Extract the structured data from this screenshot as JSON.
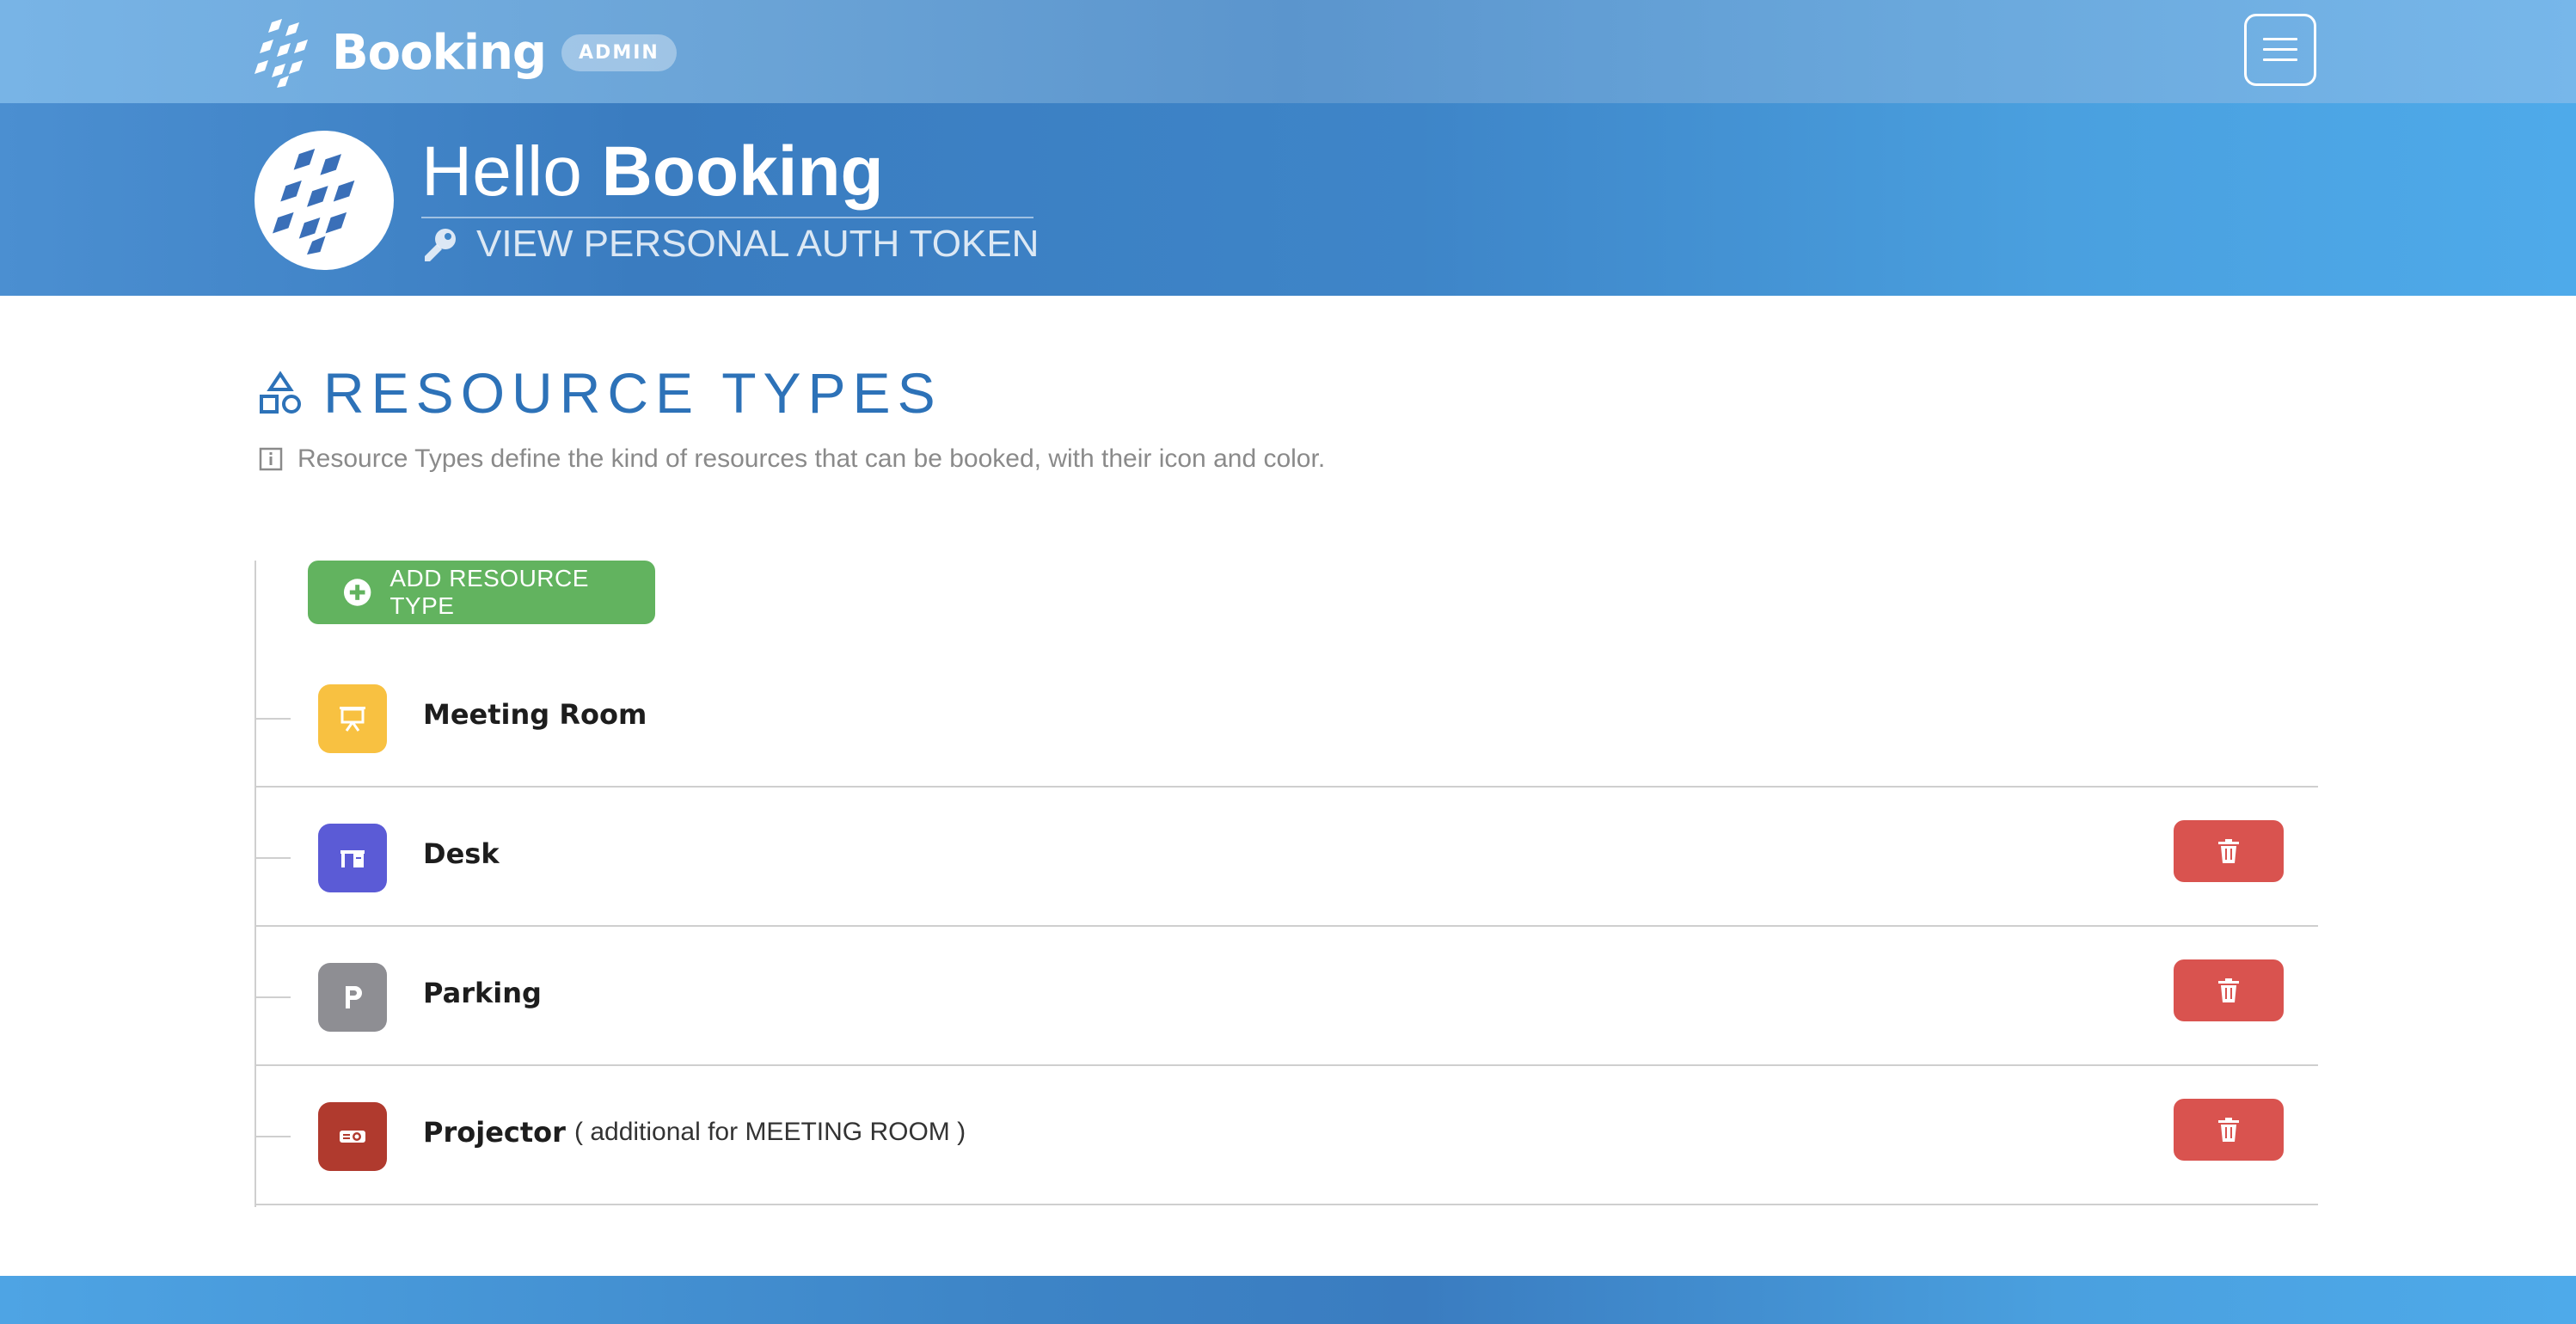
{
  "header": {
    "brand_name": "Booking",
    "badge": "ADMIN",
    "menu_icon": "hamburger-icon"
  },
  "hero": {
    "greeting": "Hello",
    "user_name": "Booking",
    "token_link": "VIEW PERSONAL AUTH TOKEN"
  },
  "section": {
    "title": "RESOURCE TYPES",
    "title_icon": "shapes-icon",
    "info": "Resource Types define the kind of resources that can be booked, with their icon and color."
  },
  "add_button": {
    "label": "ADD RESOURCE TYPE"
  },
  "resource_types": [
    {
      "name": "Meeting Room",
      "icon": "presentation-board-icon",
      "color": "#f8c141",
      "extra": "",
      "deletable": false
    },
    {
      "name": "Desk",
      "icon": "desk-icon",
      "color": "#5b5bd6",
      "extra": "",
      "deletable": true
    },
    {
      "name": "Parking",
      "icon": "parking-icon",
      "color": "#8e8e93",
      "extra": "",
      "deletable": true
    },
    {
      "name": "Projector",
      "icon": "projector-icon",
      "color": "#b03a2e",
      "extra": "( additional for  MEETING ROOM )",
      "deletable": true
    }
  ],
  "colors": {
    "accent": "#2d72b8",
    "add_button": "#62b35f",
    "delete_button": "#d9534f"
  }
}
